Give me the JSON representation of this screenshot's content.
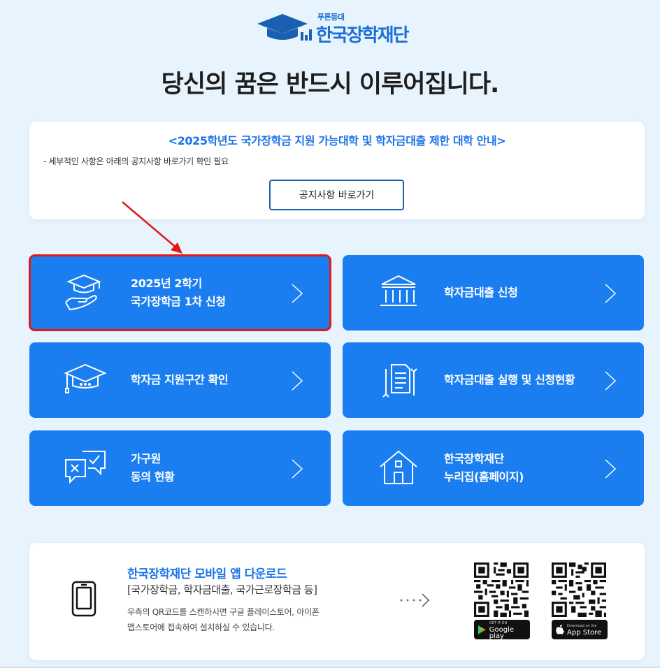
{
  "logo": {
    "small_text": "푸른등대",
    "main_text": "한국장학재단"
  },
  "headline": "당신의 꿈은 반드시 이루어집니다.",
  "notice": {
    "title": "<2025학년도 국가장학금 지원 가능대학 및 학자금대출 제한 대학 안내>",
    "description": "- 세부적인 사항은 아래의 공지사항 바로가기 확인 필요",
    "button_label": "공지사항 바로가기"
  },
  "menu": [
    {
      "line1": "2025년 2학기",
      "line2": "국가장학금 1차 신청",
      "icon": "graduation-cap-hand-icon",
      "selected": true
    },
    {
      "line1": "학자금대출 신청",
      "line2": "",
      "icon": "bank-building-icon"
    },
    {
      "line1": "학자금 지원구간 확인",
      "line2": "",
      "icon": "graduation-cap-icon"
    },
    {
      "line1": "학자금대출 실행 및 신청현황",
      "line2": "",
      "icon": "document-refresh-icon"
    },
    {
      "line1": "가구원",
      "line2": "동의 현황",
      "icon": "consent-chat-icon"
    },
    {
      "line1": "한국장학재단",
      "line2": "누리집(홈페이지)",
      "icon": "home-icon"
    }
  ],
  "app_download": {
    "title": "한국장학재단 모바일 앱 다운로드",
    "subtitle": "[국가장학금, 학자금대출, 국가근로장학금 등]",
    "description_line1": "우측의 QR코드를 스캔하시면 구글 플레이스토어, 아이폰",
    "description_line2": "앱스토어에 접속하여 설치하실 수 있습니다.",
    "google_small": "GET IT ON",
    "google_big": "Google play",
    "apple_small": "Download on the",
    "apple_big": "App Store"
  },
  "colors": {
    "primary": "#1b7ef0",
    "highlight": "#e01818",
    "background": "#e8f4fd"
  }
}
